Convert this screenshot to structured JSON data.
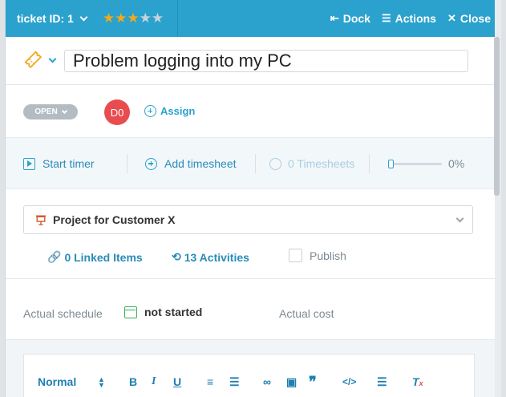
{
  "header": {
    "ticket_label": "ticket ID: 1",
    "rating": 3,
    "rating_max": 5,
    "actions": [
      {
        "label": "Dock",
        "icon": "dock-icon"
      },
      {
        "label": "Actions",
        "icon": "menu-icon"
      },
      {
        "label": "Close",
        "icon": "close-icon"
      }
    ],
    "color": "#2aa2cd"
  },
  "title": {
    "value": "Problem logging into my PC"
  },
  "status": {
    "label": "OPEN",
    "assignee_initials": "D0",
    "assign_label": "Assign"
  },
  "timer": {
    "start_label": "Start timer",
    "add_timesheet_label": "Add timesheet",
    "timesheets_label": "0 Timesheets",
    "progress_label": "0%",
    "progress": 0
  },
  "project": {
    "selected": "Project for Customer X",
    "linked_items": "0 Linked Items",
    "activities": "13 Activities",
    "publish_label": "Publish"
  },
  "schedule": {
    "actual_schedule_label": "Actual schedule",
    "actual_schedule_value": "not started",
    "actual_cost_label": "Actual cost"
  },
  "editor": {
    "format_label": "Normal"
  }
}
